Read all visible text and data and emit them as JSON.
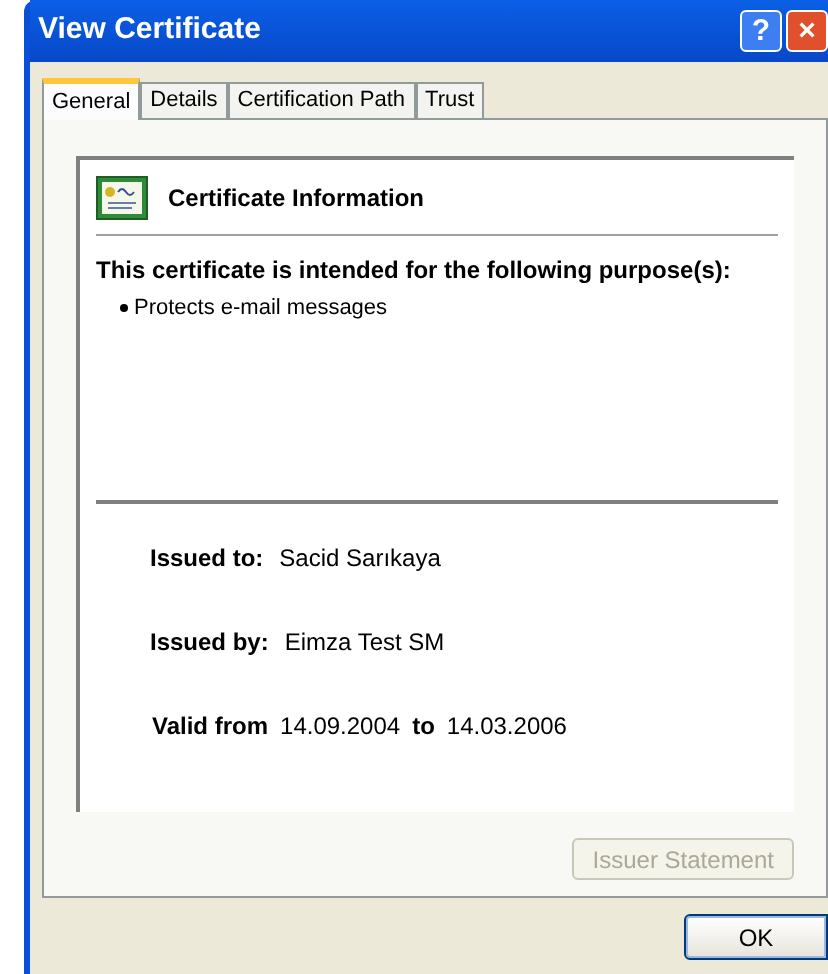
{
  "window": {
    "title": "View Certificate",
    "buttons": [
      {
        "kind": "help",
        "label": "?"
      },
      {
        "kind": "close",
        "label": "×"
      }
    ]
  },
  "tabs": [
    {
      "label": "General",
      "selected": true
    },
    {
      "label": "Details",
      "selected": false
    },
    {
      "label": "Certification Path",
      "selected": false
    },
    {
      "label": "Trust",
      "selected": false
    }
  ],
  "certificate": {
    "heading": "Certificate Information",
    "purpose_heading": "This certificate is intended for the following purpose(s):",
    "purposes": [
      "Protects e-mail messages"
    ],
    "issued_to": {
      "label": "Issued to:",
      "value": "Sacid Sarıkaya"
    },
    "issued_by": {
      "label": "Issued by:",
      "value": "Eimza Test SM"
    },
    "validity": {
      "from_label": "Valid from",
      "from": "14.09.2004",
      "to_label": "to",
      "to": "14.03.2006"
    }
  },
  "issuer_statement": {
    "label": "Issuer Statement",
    "disabled": true
  },
  "ok_button": {
    "label": "OK"
  }
}
